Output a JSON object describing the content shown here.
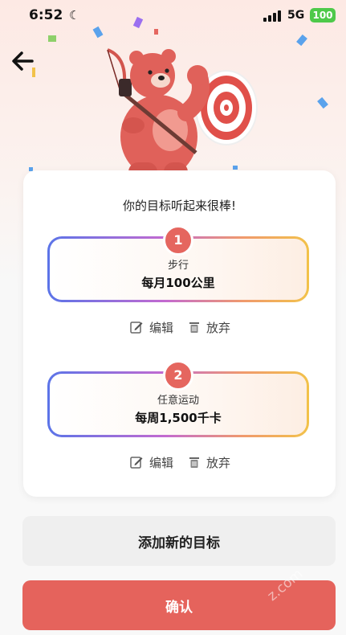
{
  "status_bar": {
    "time": "6:52",
    "network": "5G",
    "battery": "100"
  },
  "header": {
    "back_icon": "arrow-left-icon"
  },
  "card": {
    "title": "你的目标听起来很棒!",
    "goals": [
      {
        "number": "1",
        "type": "步行",
        "value": "每月100公里",
        "edit_label": "编辑",
        "discard_label": "放弃"
      },
      {
        "number": "2",
        "type": "任意运动",
        "value": "每周1,500千卡",
        "edit_label": "编辑",
        "discard_label": "放弃"
      }
    ]
  },
  "buttons": {
    "add_label": "添加新的目标",
    "confirm_label": "确认"
  },
  "watermark": "z.com",
  "colors": {
    "accent": "#e5635c",
    "battery": "#4ec94a"
  }
}
